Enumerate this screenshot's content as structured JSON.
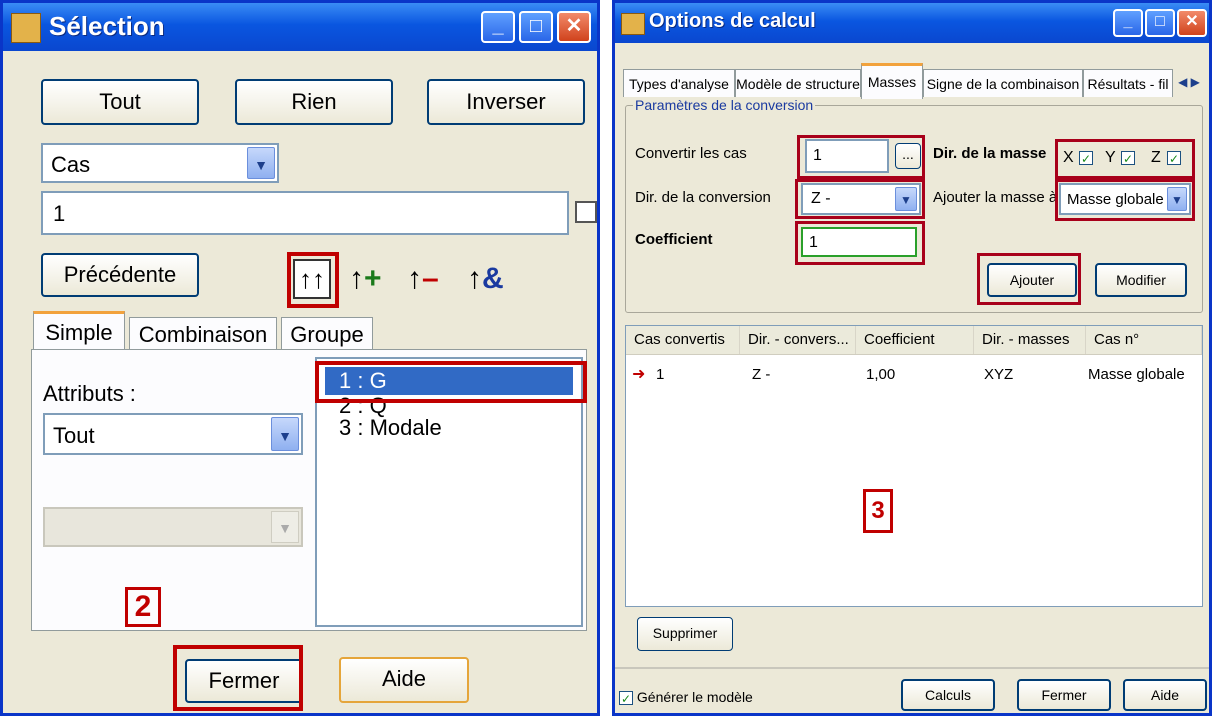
{
  "selection": {
    "title": "Sélection",
    "buttons": {
      "all": "Tout",
      "none": "Rien",
      "invert": "Inverser"
    },
    "type_select": "Cas",
    "case_input": "1",
    "previous": "Précédente",
    "tool_icons": [
      "select-all-icon",
      "add-selection-icon",
      "remove-selection-icon",
      "intersect-selection-icon"
    ],
    "tabs": [
      "Simple",
      "Combinaison",
      "Groupe"
    ],
    "attributes_label": "Attributs :",
    "attributes_select": "Tout",
    "cases": [
      "1 : G",
      "2 : Q",
      "3 : Modale"
    ],
    "marker_2": "2",
    "close": "Fermer",
    "help": "Aide"
  },
  "options": {
    "title": "Options de calcul",
    "tabs": [
      "Types d'analyse",
      "Modèle de structure",
      "Masses",
      "Signe de la combinaison",
      "Résultats - fil"
    ],
    "group_title": "Paramètres de la conversion",
    "convert_label": "Convertir les cas",
    "convert_value": "1",
    "browse": "...",
    "mass_dir_label": "Dir. de la masse",
    "axes": [
      "X",
      "Y",
      "Z"
    ],
    "conv_dir_label": "Dir. de la conversion",
    "conv_dir_value": "Z -",
    "add_mass_label": "Ajouter la masse à",
    "add_mass_value": "Masse globale",
    "coef_label": "Coefficient",
    "coef_value": "1",
    "add": "Ajouter",
    "modify": "Modifier",
    "table": {
      "headers": [
        "Cas convertis",
        "Dir. - convers...",
        "Coefficient",
        "Dir. - masses",
        "Cas n°"
      ],
      "rows": [
        [
          "1",
          "Z -",
          "1,00",
          "XYZ",
          "Masse globale"
        ]
      ]
    },
    "marker_3": "3",
    "delete": "Supprimer",
    "generate_model": "Générer le modèle",
    "calc": "Calculs",
    "close": "Fermer",
    "help": "Aide",
    "colors": {
      "titlebar": "#0a56e0",
      "highlight": "#c00000",
      "selection": "#316ac5"
    }
  }
}
